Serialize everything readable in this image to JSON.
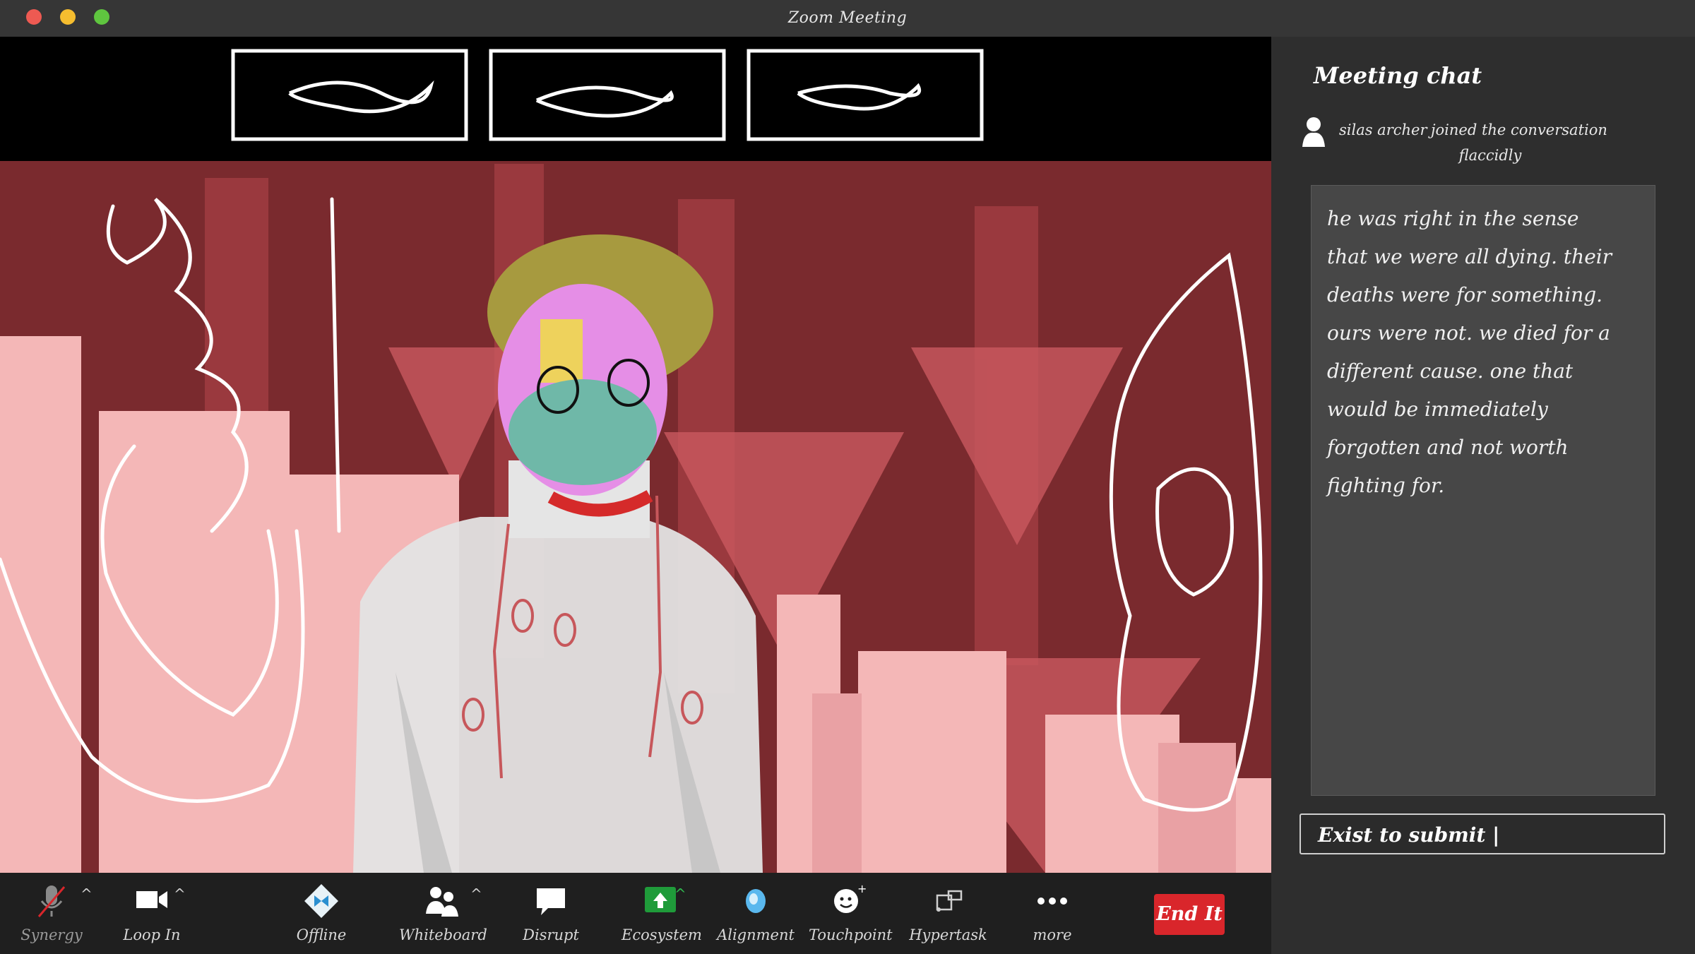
{
  "window": {
    "title": "Zoom Meeting"
  },
  "chat": {
    "title": "Meeting chat",
    "join_event": {
      "name": "silas archer",
      "text": "joined the conversation",
      "adverb": "flaccidly"
    },
    "message_lines": [
      "he was right in the sense",
      "that we were all dying. their",
      "deaths were for something.",
      "ours were not. we died for a",
      "different cause. one that",
      "would be immediately",
      "forgotten and not worth",
      "fighting for."
    ],
    "input_value": "Exist to submit |"
  },
  "toolbar": {
    "synergy": "Synergy",
    "loop_in": "Loop In",
    "offline": "Offline",
    "whiteboard": "Whiteboard",
    "disrupt": "Disrupt",
    "ecosystem": "Ecosystem",
    "alignment": "Alignment",
    "touchpoint": "Touchpoint",
    "hypertask": "Hypertask",
    "more": "more",
    "end": "End It"
  },
  "colors": {
    "end_button": "#d9262b",
    "video_bg": "#7a2a2e",
    "ecosystem_icon": "#1f9b3a",
    "alignment_icon": "#5ab8ee"
  }
}
